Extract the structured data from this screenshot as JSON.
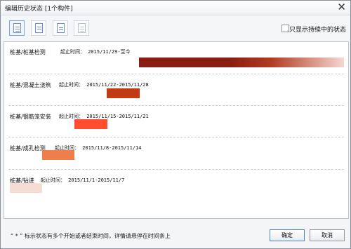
{
  "window": {
    "title": "编辑历史状态 [1个构件]",
    "close_glyph": "✕"
  },
  "toolbar": {
    "buttons": [
      {
        "name": "toolbar-button-1",
        "active": true
      },
      {
        "name": "toolbar-button-2"
      },
      {
        "name": "toolbar-button-3"
      },
      {
        "name": "toolbar-button-4",
        "disabled": true
      }
    ],
    "checkbox": {
      "checked": false,
      "label": "只显示持续中的状态"
    }
  },
  "rows": [
    {
      "label": "桩基/桩基检测",
      "date_prefix": "起止时间：",
      "date_range": "2015/11/29-至今",
      "color": "#8b1e12",
      "style": "gradient"
    },
    {
      "label": "桩基/混凝土浇筑",
      "date_prefix": "起止时间：",
      "date_range": "2015/11/22-2015/11/28",
      "color": "#c13a12",
      "style": "solid"
    },
    {
      "label": "桩基/钢筋笼安装",
      "date_prefix": "起止时间：",
      "date_range": "2015/11/15-2015/11/21",
      "color": "#ff4d2f",
      "style": "solid"
    },
    {
      "label": "桩基/成孔检测",
      "date_prefix": "起止时间：",
      "date_range": "2015/11/8-2015/11/14",
      "color": "#ef7e4a",
      "style": "solid"
    },
    {
      "label": "桩基/钻进",
      "date_prefix": "起止时间：",
      "date_range": "2015/11/1-2015/11/7",
      "color": "#f6ddd4",
      "style": "solid"
    }
  ],
  "footer": {
    "note": "“ * ” 标示状态有多个开始或者结束时间，详情请悬停在时间条上",
    "ok": "确定",
    "cancel": "取消"
  }
}
